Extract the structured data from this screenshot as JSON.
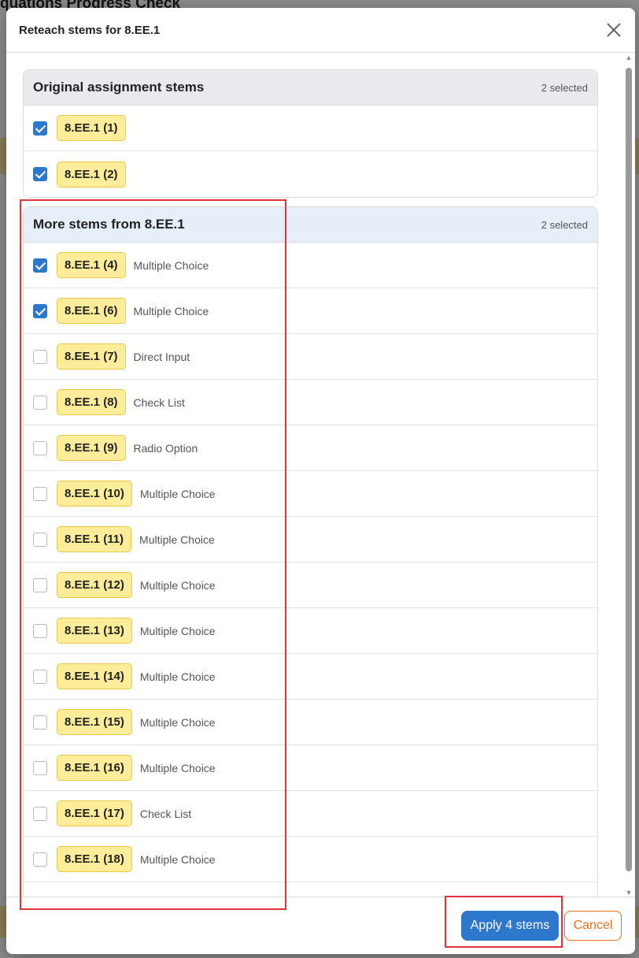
{
  "background": {
    "page_title": "quations Progress Check"
  },
  "modal": {
    "title": "Reteach stems for 8.EE.1",
    "original_section": {
      "title": "Original assignment stems",
      "count": "2 selected",
      "items": [
        {
          "label": "8.EE.1 (1)",
          "type": "",
          "checked": true
        },
        {
          "label": "8.EE.1 (2)",
          "type": "",
          "checked": true
        }
      ]
    },
    "more_section": {
      "title": "More stems from 8.EE.1",
      "count": "2 selected",
      "items": [
        {
          "label": "8.EE.1 (4)",
          "type": "Multiple Choice",
          "checked": true
        },
        {
          "label": "8.EE.1 (6)",
          "type": "Multiple Choice",
          "checked": true
        },
        {
          "label": "8.EE.1 (7)",
          "type": "Direct Input",
          "checked": false
        },
        {
          "label": "8.EE.1 (8)",
          "type": "Check List",
          "checked": false
        },
        {
          "label": "8.EE.1 (9)",
          "type": "Radio Option",
          "checked": false
        },
        {
          "label": "8.EE.1 (10)",
          "type": "Multiple Choice",
          "checked": false
        },
        {
          "label": "8.EE.1 (11)",
          "type": "Multiple Choice",
          "checked": false
        },
        {
          "label": "8.EE.1 (12)",
          "type": "Multiple Choice",
          "checked": false
        },
        {
          "label": "8.EE.1 (13)",
          "type": "Multiple Choice",
          "checked": false
        },
        {
          "label": "8.EE.1 (14)",
          "type": "Multiple Choice",
          "checked": false
        },
        {
          "label": "8.EE.1 (15)",
          "type": "Multiple Choice",
          "checked": false
        },
        {
          "label": "8.EE.1 (16)",
          "type": "Multiple Choice",
          "checked": false
        },
        {
          "label": "8.EE.1 (17)",
          "type": "Check List",
          "checked": false
        },
        {
          "label": "8.EE.1 (18)",
          "type": "Multiple Choice",
          "checked": false
        },
        {
          "label": "",
          "type": "",
          "checked": false
        }
      ]
    },
    "footer": {
      "apply_label": "Apply 4 stems",
      "cancel_label": "Cancel"
    }
  },
  "colors": {
    "primary": "#2d77cc",
    "cancel": "#e8721f",
    "badge": "#fdec99",
    "highlight": "#e0353c"
  }
}
